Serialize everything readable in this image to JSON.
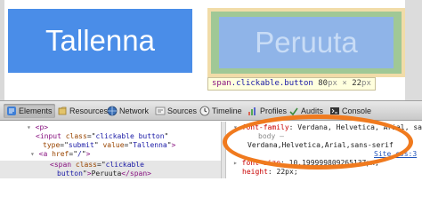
{
  "page": {
    "save_button_label": "Tallenna",
    "cancel_button_label": "Peruuta",
    "size_tooltip": {
      "selector_tag": "span",
      "selector_class": ".clickable.button",
      "width": "80",
      "height": "22",
      "unit": "px",
      "separator": "×"
    }
  },
  "toolbar": {
    "items": [
      {
        "label": "Elements",
        "icon": "elements-icon"
      },
      {
        "label": "Resources",
        "icon": "resources-icon"
      },
      {
        "label": "Network",
        "icon": "network-icon"
      },
      {
        "label": "Sources",
        "icon": "sources-icon"
      },
      {
        "label": "Timeline",
        "icon": "timeline-icon"
      },
      {
        "label": "Profiles",
        "icon": "profiles-icon"
      },
      {
        "label": "Audits",
        "icon": "audits-icon"
      },
      {
        "label": "Console",
        "icon": "console-icon"
      }
    ]
  },
  "elements": {
    "p_tag": "<p>",
    "input_line": {
      "open": "<input ",
      "class_attr": "class",
      "class_val": "clickable button",
      "type_attr": "type",
      "type_val": "submit",
      "value_attr": "value",
      "value_val": "Tallenna",
      "close": ">"
    },
    "a_line": {
      "open": "<a ",
      "href_attr": "href",
      "href_val": "/",
      "close": ">"
    },
    "span_line": {
      "open": "<span ",
      "class_attr": "class",
      "class_val": "clickable",
      "cont_val": "button",
      "close_open": ">",
      "text": "Peruuta",
      "end": "</span>"
    }
  },
  "styles": {
    "font_family_prop": "font-family",
    "font_family_value": "Verdana, Helvetica, Arial, sans-serif;",
    "body_comment": "body –",
    "inherited_value": "Verdana,Helvetica,Arial,sans-serif",
    "source_link": "Site.css:3",
    "font_size_prop": "font-size",
    "font_size_value": "10.199999809265137px;",
    "height_prop": "height",
    "height_value": "22px;"
  },
  "colors": {
    "button_blue": "#4a8de8",
    "annotation_orange": "#f07a1e"
  }
}
